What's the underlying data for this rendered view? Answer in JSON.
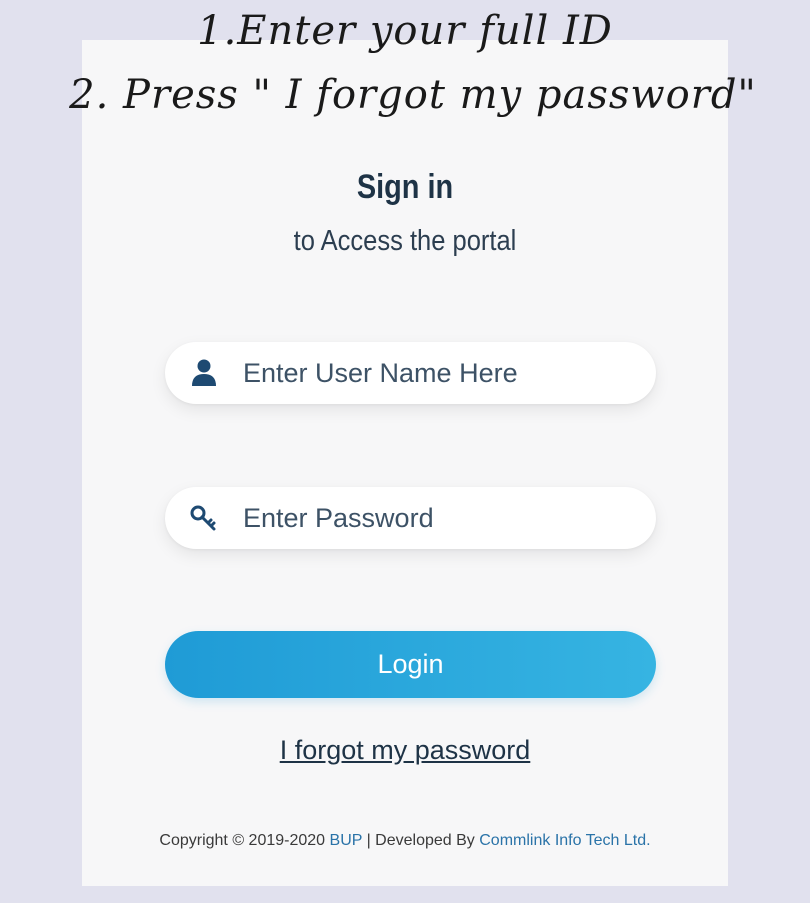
{
  "annotation": {
    "line1": "1.Enter your full ID",
    "line2": "2. Press \" I forgot my password\""
  },
  "login_form": {
    "title": "Sign in",
    "subtitle": "to Access the portal",
    "username_placeholder": "Enter User Name Here",
    "username_icon": "user-icon",
    "password_placeholder": "Enter Password",
    "password_icon": "key-icon",
    "login_label": "Login",
    "forgot_label": "I forgot my password"
  },
  "footer": {
    "copyright": "Copyright © 2019-2020",
    "org": "BUP",
    "separator": "| Developed By",
    "developer": "Commlink Info Tech Ltd."
  },
  "colors": {
    "background": "#e1e1ee",
    "panel": "#f7f7f8",
    "title": "#1e3346",
    "button_start": "#1f9bd6",
    "button_end": "#36b4e2",
    "link": "#2a73a8"
  }
}
